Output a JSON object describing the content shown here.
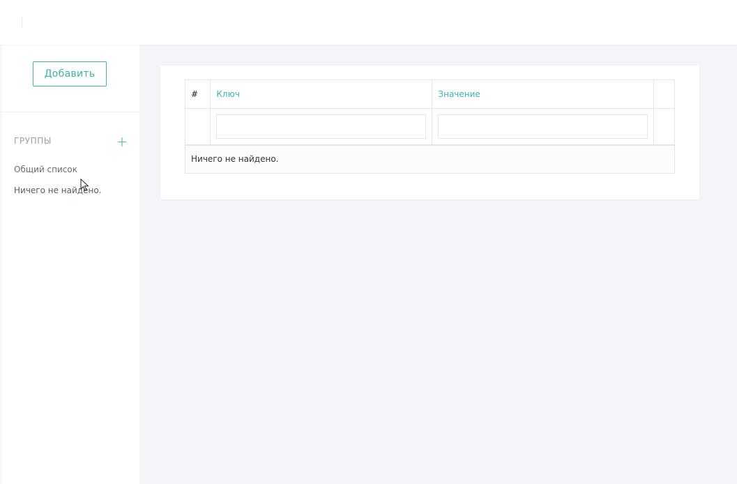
{
  "sidebar": {
    "add_label": "Добавить",
    "groups_title": "ГРУППЫ",
    "groups_add_symbol": "+",
    "group_all": "Общий список",
    "groups_empty": "Ничего не найдено."
  },
  "table": {
    "col_num": "#",
    "col_key": "Ключ",
    "col_value": "Значение",
    "filter_key_value": "",
    "filter_value_value": "",
    "empty_text": "Ничего не найдено."
  },
  "colors": {
    "accent": "#3cb4a8",
    "background": "#f4f5f9",
    "border": "#e3e5ea"
  }
}
